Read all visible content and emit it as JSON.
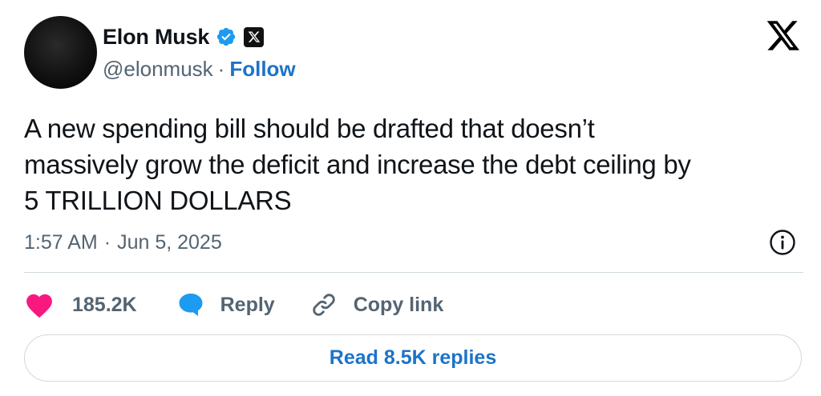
{
  "author": {
    "name": "Elon Musk",
    "handle": "@elonmusk",
    "separator": "·",
    "follow_label": "Follow",
    "badge_icon": "verified-badge-icon",
    "affiliate_icon": "x-affiliate-icon"
  },
  "tweet": {
    "text_lines": [
      "A new spending bill should be drafted that doesn’t",
      "massively grow the deficit and increase the debt ceiling by",
      "5 TRILLION DOLLARS"
    ],
    "time": "1:57 AM",
    "separator": "·",
    "date": "Jun 5, 2025"
  },
  "actions": {
    "like_count": "185.2K",
    "reply_label": "Reply",
    "copy_link_label": "Copy link"
  },
  "footer": {
    "read_replies_label": "Read 8.5K replies"
  },
  "colors": {
    "heart": "#f91880",
    "reply_bubble": "#1d9bf0",
    "link_blue": "#1d73c9",
    "verified": "#1d9bf0"
  }
}
